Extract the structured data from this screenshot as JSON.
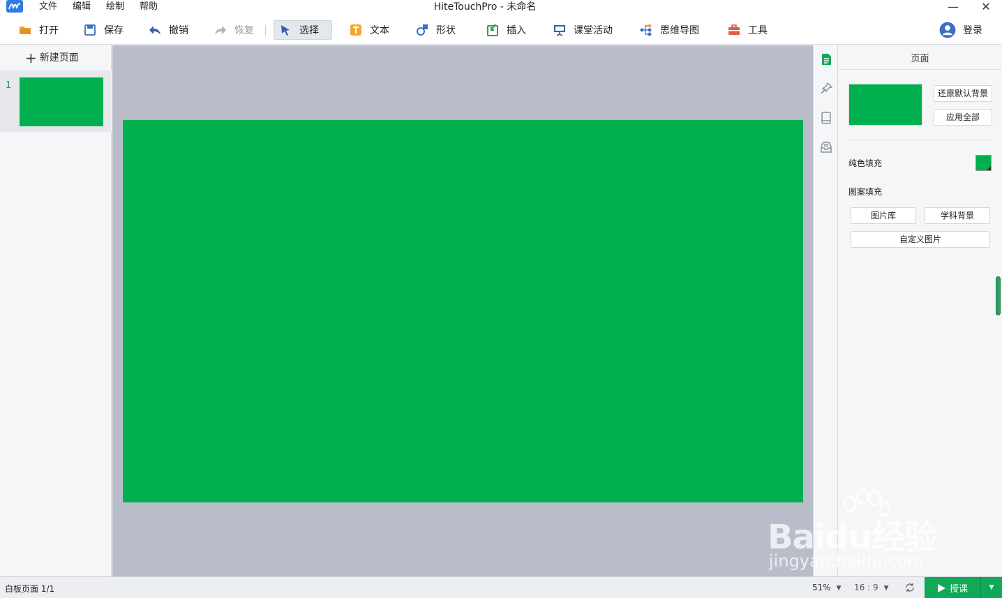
{
  "titlebar": {
    "menu": [
      "文件",
      "编辑",
      "绘制",
      "帮助"
    ],
    "window_title": "HiteTouchPro - 未命名"
  },
  "toolbar": {
    "open": "打开",
    "save": "保存",
    "undo": "撤销",
    "redo": "恢复",
    "select": "选择",
    "text": "文本",
    "shape": "形状",
    "insert": "插入",
    "class_activity": "课堂活动",
    "mindmap": "思维导图",
    "tools": "工具",
    "login": "登录"
  },
  "pages": {
    "new_page": "新建页面",
    "items": [
      {
        "number": "1",
        "bg_color": "#00b04f"
      }
    ]
  },
  "canvas": {
    "bg_color": "#00b04f"
  },
  "properties": {
    "title": "页面",
    "restore_default_bg": "还原默认背景",
    "apply_all": "应用全部",
    "solid_fill": "纯色填充",
    "solid_color": "#00b04f",
    "pattern_fill": "图案填充",
    "image_library": "图片库",
    "subject_bg": "学科背景",
    "custom_image": "自定义图片"
  },
  "status": {
    "page_info": "白板页面 1/1",
    "zoom": "51%",
    "ratio": "16 : 9",
    "present": "授课"
  },
  "watermark": {
    "line1": "Baidu经验",
    "line2": "jingyan.baidu.com"
  },
  "icons": [
    "app-logo-icon",
    "folder-icon",
    "save-icon",
    "undo-icon",
    "redo-icon",
    "cursor-icon",
    "text-icon",
    "shape-icon",
    "insert-icon",
    "presentation-icon",
    "mindmap-icon",
    "toolbox-icon",
    "user-icon",
    "page-icon",
    "pin-icon",
    "book-icon",
    "inbox-icon",
    "sync-icon",
    "play-icon"
  ]
}
